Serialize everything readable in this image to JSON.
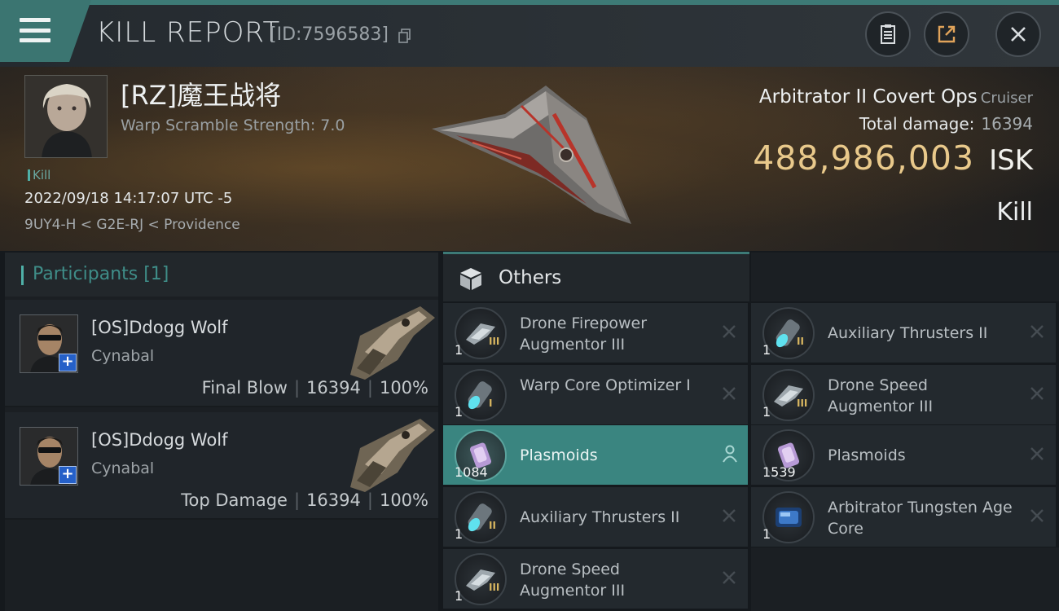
{
  "header": {
    "title": "KILL REPORT",
    "report_id": "[ID:7596583]",
    "icons": [
      "menu-icon",
      "clipboard-icon",
      "share-icon",
      "close-icon"
    ]
  },
  "victim": {
    "name": "[RZ]魔王战将",
    "warp_scramble": "Warp Scramble Strength: 7.0",
    "tag": "Kill",
    "datetime": "2022/09/18 14:17:07 UTC -5",
    "location": "9UY4-H < G2E-RJ < Providence",
    "ship_name": "Arbitrator II Covert Ops",
    "ship_class": "Cruiser",
    "total_damage_label": "Total damage:",
    "total_damage_value": "16394",
    "isk_value": "488,986,003",
    "isk_unit": "ISK",
    "result": "Kill"
  },
  "participants": {
    "title": "Participants [1]",
    "list": [
      {
        "name": "[OS]Ddogg Wolf",
        "ship": "Cynabal",
        "role": "Final Blow",
        "damage": "16394",
        "percent": "100%"
      },
      {
        "name": "[OS]Ddogg Wolf",
        "ship": "Cynabal",
        "role": "Top Damage",
        "damage": "16394",
        "percent": "100%"
      }
    ]
  },
  "others": {
    "title": "Others",
    "left": [
      {
        "name": "Drone Firepower Augmentor III",
        "qty": "1",
        "meta": "III",
        "icon": "drone-augmentor-icon",
        "state": "destroyed"
      },
      {
        "name": "Warp Core Optimizer I",
        "qty": "1",
        "meta": "I",
        "icon": "thruster-icon",
        "state": "destroyed"
      },
      {
        "name": "Plasmoids",
        "qty": "1084",
        "meta": "",
        "icon": "plasmoid-icon",
        "state": "dropped"
      },
      {
        "name": "Auxiliary Thrusters II",
        "qty": "1",
        "meta": "II",
        "icon": "thruster-icon",
        "state": "destroyed"
      },
      {
        "name": "Drone Speed Augmentor III",
        "qty": "1",
        "meta": "III",
        "icon": "drone-augmentor-icon",
        "state": "destroyed"
      }
    ],
    "right": [
      {
        "name": "Auxiliary Thrusters II",
        "qty": "1",
        "meta": "II",
        "icon": "thruster-icon",
        "state": "destroyed"
      },
      {
        "name": "Drone Speed Augmentor III",
        "qty": "1",
        "meta": "III",
        "icon": "drone-augmentor-icon",
        "state": "destroyed"
      },
      {
        "name": "Plasmoids",
        "qty": "1539",
        "meta": "",
        "icon": "plasmoid-icon",
        "state": "destroyed"
      },
      {
        "name": "Arbitrator Tungsten Age Core",
        "qty": "1",
        "meta": "",
        "icon": "core-icon",
        "state": "destroyed"
      }
    ]
  },
  "colors": {
    "accent": "#3d7a76",
    "isk": "#e9c98b",
    "selected_row": "#3a8580"
  }
}
